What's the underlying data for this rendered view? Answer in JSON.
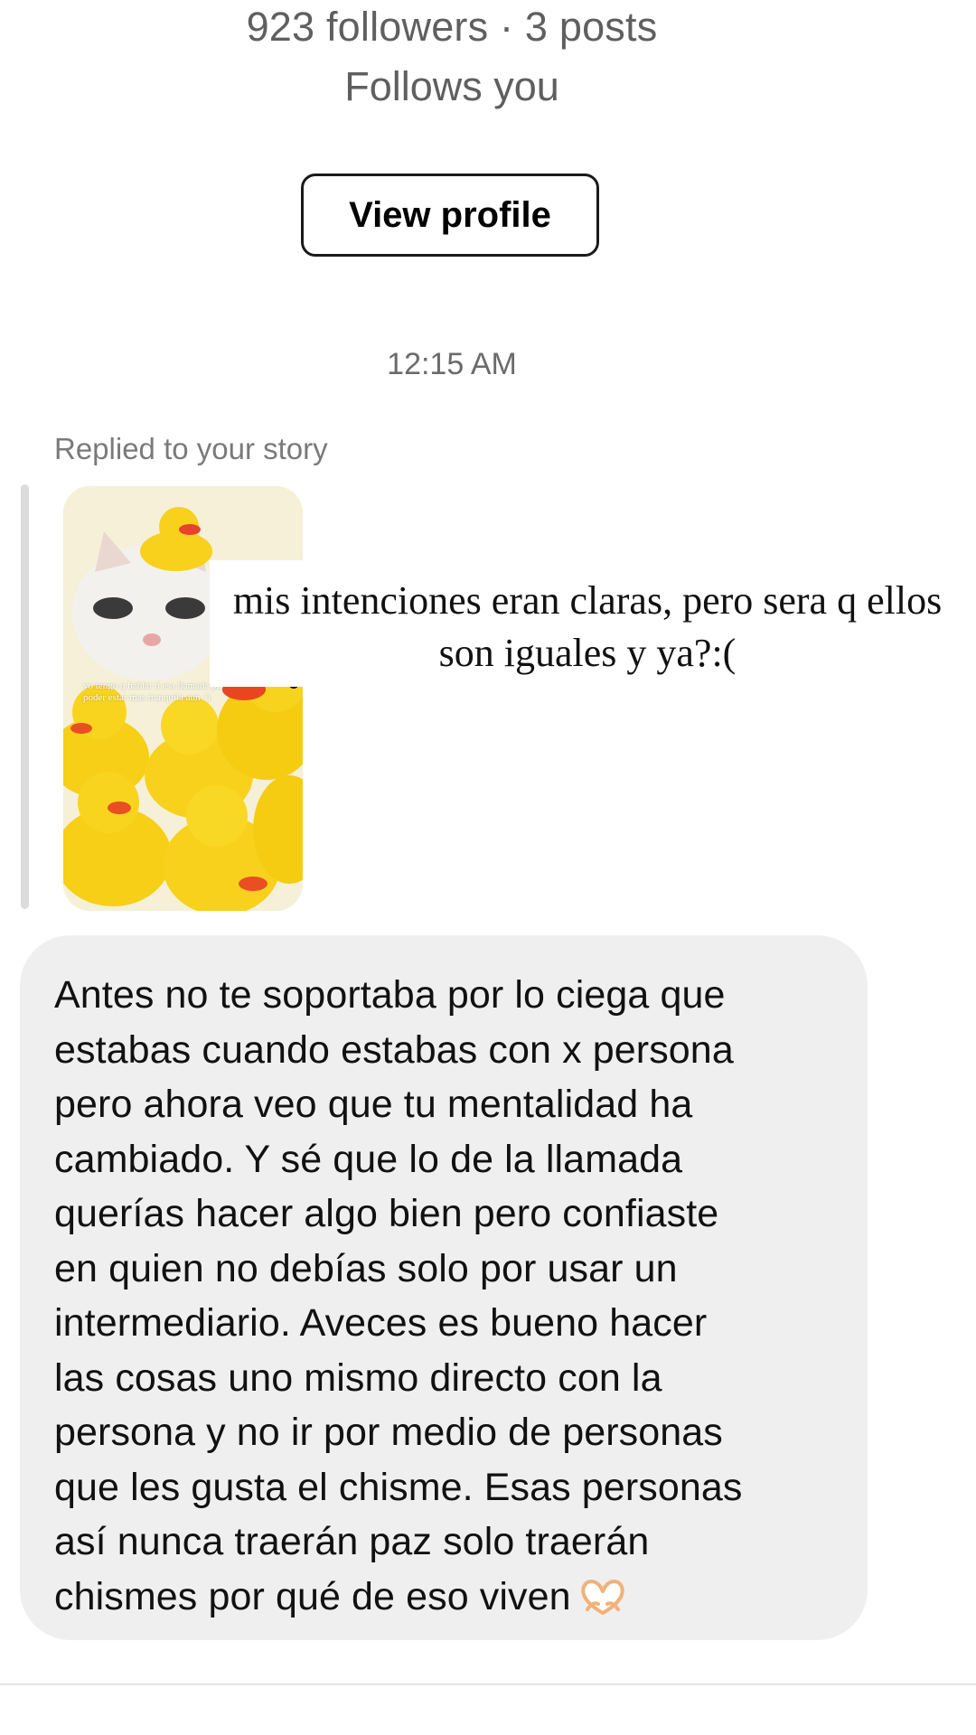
{
  "profile": {
    "stats": "923 followers · 3 posts",
    "follows_you": "Follows you",
    "view_profile_label": "View profile"
  },
  "thread": {
    "timestamp": "12:15 AM",
    "replied_label": "Replied to your story"
  },
  "story": {
    "overlay_text": "yo tengo q hablar d esa llamada pa poder estar mas tranquila aun :')",
    "caption": "mis intenciones eran claras, pero sera q ellos son iguales y ya?:("
  },
  "message": {
    "text": "Antes no te soportaba por lo ciega que\nestabas cuando estabas con x persona\npero ahora veo que tu mentalidad ha\ncambiado. Y sé que lo de la llamada\nquerías hacer algo bien pero confiaste\nen quien no debías solo por usar un\nintermediario. Aveces es bueno hacer\nlas cosas uno mismo directo con la\npersona y no ir por medio de personas\nque les gusta el chisme. Esas personas\nasí nunca traerán paz solo traerán\nchismes por qué de eso viven",
    "emoji_icon": "heart-hands-icon"
  },
  "colors": {
    "background": "#ffffff",
    "bubble": "#efefef",
    "secondary_text": "#5f5f5f"
  }
}
